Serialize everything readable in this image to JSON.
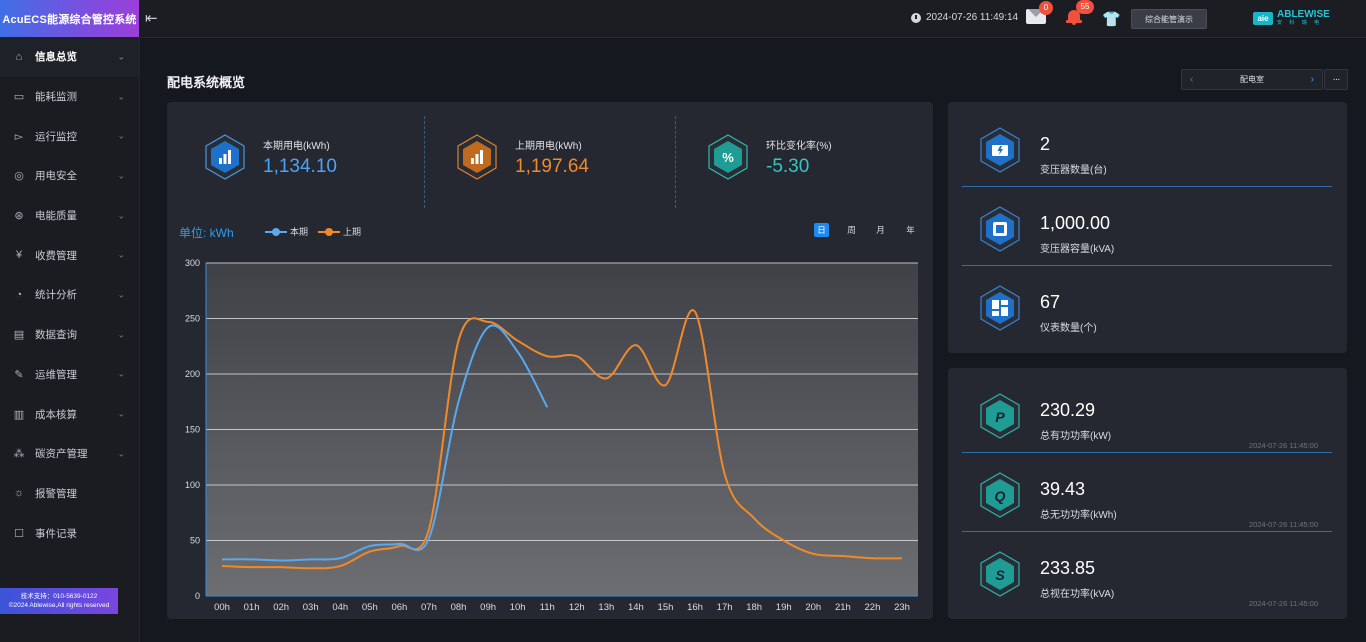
{
  "app": {
    "title": "AcuECS能源综合管控系统"
  },
  "sidebar": {
    "items": [
      {
        "label": "信息总览",
        "icon": "home-icon",
        "active": true,
        "has_children": true
      },
      {
        "label": "能耗监测",
        "icon": "monitor-icon",
        "has_children": true
      },
      {
        "label": "运行监控",
        "icon": "camera-icon",
        "has_children": true
      },
      {
        "label": "用电安全",
        "icon": "shield-search-icon",
        "has_children": true
      },
      {
        "label": "电能质量",
        "icon": "gauge-icon",
        "has_children": true
      },
      {
        "label": "收费管理",
        "icon": "yen-icon",
        "has_children": true
      },
      {
        "label": "统计分析",
        "icon": "pie-icon",
        "has_children": true
      },
      {
        "label": "数据查询",
        "icon": "document-icon",
        "has_children": true
      },
      {
        "label": "运维管理",
        "icon": "edit-icon",
        "has_children": true
      },
      {
        "label": "成本核算",
        "icon": "bar-chart-icon",
        "has_children": true
      },
      {
        "label": "碳资产管理",
        "icon": "nodes-icon",
        "has_children": true
      },
      {
        "label": "报警管理",
        "icon": "alarm-icon",
        "has_children": false
      },
      {
        "label": "事件记录",
        "icon": "record-icon",
        "has_children": false
      }
    ],
    "support_line1": "技术支持：010-5639-0122",
    "support_line2": "©2024 Ablewise,All rights reserved"
  },
  "topbar": {
    "datetime": "2024-07-26 11:49:14",
    "mail_count": "0",
    "alarm_count": "55",
    "demo_button": "综合能管演示",
    "brand_name": "ABLEWISE",
    "brand_sub": "安 科 瑞 电",
    "brand_mark": "aie"
  },
  "page": {
    "title": "配电系统概览",
    "room_selector": "配电室",
    "more": "···"
  },
  "stats": [
    {
      "label": "本期用电(kWh)",
      "value": "1,134.10",
      "color": "#4da3f5",
      "icon": "bar-chart-icon"
    },
    {
      "label": "上期用电(kWh)",
      "value": "1,197.64",
      "color": "#f08a2c",
      "icon": "bar-chart-icon"
    },
    {
      "label": "环比变化率(%)",
      "value": "-5.30",
      "color": "#35c6bf",
      "icon": "percent-icon"
    }
  ],
  "chart_controls": {
    "unit": "单位: kWh",
    "legend_current": "本期",
    "legend_previous": "上期",
    "periods": [
      "日",
      "周",
      "月",
      "年"
    ],
    "active_period": "日"
  },
  "chart_data": {
    "type": "line",
    "x": [
      "00h",
      "01h",
      "02h",
      "03h",
      "04h",
      "05h",
      "06h",
      "07h",
      "08h",
      "09h",
      "10h",
      "11h",
      "12h",
      "13h",
      "14h",
      "15h",
      "16h",
      "17h",
      "18h",
      "19h",
      "20h",
      "21h",
      "22h",
      "23h"
    ],
    "ylim": [
      0,
      300
    ],
    "yticks": [
      0,
      50,
      100,
      150,
      200,
      250,
      300
    ],
    "series": [
      {
        "name": "本期",
        "color": "#5aa8ee",
        "values": [
          33,
          33,
          32,
          33,
          34,
          45,
          47,
          52,
          175,
          242,
          220,
          170
        ]
      },
      {
        "name": "上期",
        "color": "#f0892a",
        "values": [
          27,
          26,
          26,
          25,
          27,
          40,
          45,
          60,
          230,
          247,
          230,
          216,
          216,
          196,
          226,
          190,
          256,
          110,
          70,
          50,
          38,
          36,
          34,
          34
        ]
      }
    ],
    "grid": true
  },
  "transformer": [
    {
      "value": "2",
      "label": "变压器数量(台)",
      "icon": "transformer-icon"
    },
    {
      "value": "1,000.00",
      "label": "变压器容量(kVA)",
      "icon": "chip-icon"
    },
    {
      "value": "67",
      "label": "仪表数量(个)",
      "icon": "dashboard-icon"
    }
  ],
  "power": [
    {
      "value": "230.29",
      "label": "总有功功率(kW)",
      "time": "2024-07-26 11:45:00",
      "letter": "P"
    },
    {
      "value": "39.43",
      "label": "总无功功率(kWh)",
      "time": "2024-07-26 11:45:00",
      "letter": "Q"
    },
    {
      "value": "233.85",
      "label": "总视在功率(kVA)",
      "time": "2024-07-26 11:45:00",
      "letter": "S"
    }
  ]
}
